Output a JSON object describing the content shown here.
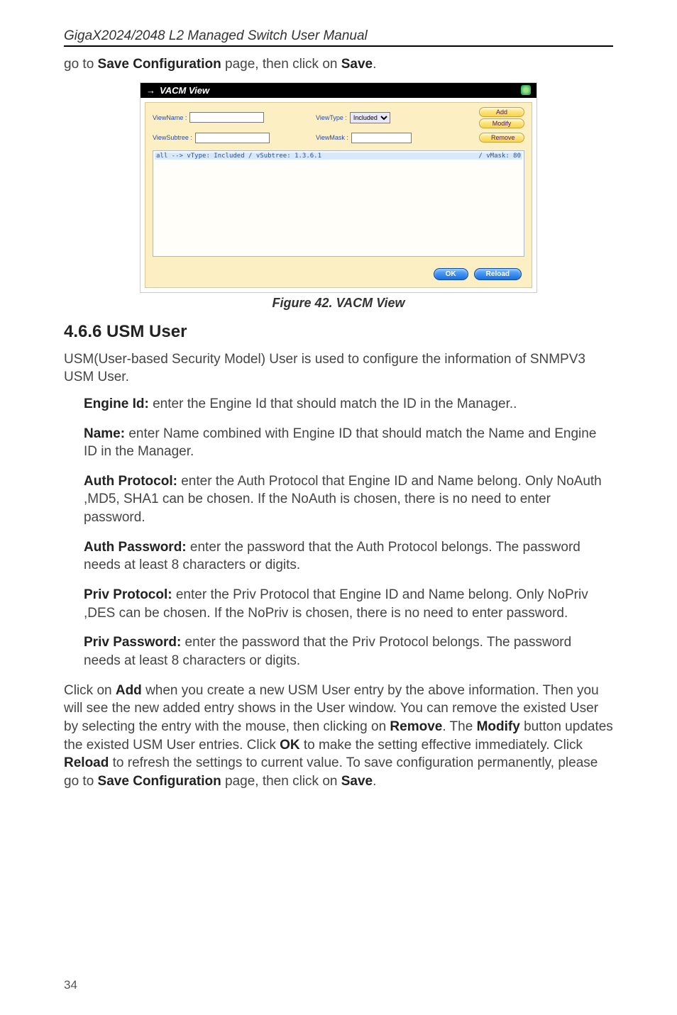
{
  "header": {
    "title": "GigaX2024/2048 L2 Managed Switch User Manual"
  },
  "intro_pre": "go to ",
  "intro_b1": "Save Configuration",
  "intro_mid": " page, then click on ",
  "intro_b2": "Save",
  "intro_end": ".",
  "figure": {
    "titlebar": "VACM View",
    "labels": {
      "viewname": "ViewName :",
      "viewtype": "ViewType :",
      "viewsubtree": "ViewSubtree :",
      "viewmask": "ViewMask :",
      "included_opt": "Included"
    },
    "buttons": {
      "add": "Add",
      "modify": "Modify",
      "remove": "Remove",
      "ok": "OK",
      "reload": "Reload"
    },
    "list_left": "all          --> vType: Included / vSubtree: 1.3.6.1",
    "list_right": "/ vMask: 80",
    "caption": "Figure 42. VACM View"
  },
  "section_heading": "4.6.6 USM User",
  "para1": "USM(User-based Security Model) User is used to configure the information of SNMPV3 USM User.",
  "engine": {
    "label": "Engine Id:",
    "text": " enter the Engine Id that should match the ID in the Manager.."
  },
  "name": {
    "label": "Name:",
    "text": " enter Name combined with Engine ID that should match the Name and Engine ID in the Manager."
  },
  "authproto": {
    "label": "Auth Protocol:",
    "text": " enter the Auth Protocol that Engine ID and Name belong. Only NoAuth ,MD5, SHA1 can be chosen. If the NoAuth is chosen, there is no need to enter password."
  },
  "authpass": {
    "label": "Auth Password:",
    "text": " enter the password that the Auth Protocol belongs. The password needs at least 8 characters or digits."
  },
  "privproto": {
    "label": "Priv Protocol:",
    "text": " enter the Priv Protocol that Engine ID and Name belong. Only NoPriv ,DES can be chosen. If the NoPriv is chosen, there is no need to enter password."
  },
  "privpass": {
    "label": "Priv Password:",
    "text": " enter the password that the Priv Protocol belongs. The password needs at least 8 characters or digits."
  },
  "final": {
    "t1": "Click on ",
    "b1": "Add",
    "t2": " when you create a new USM User entry by the above information. Then you will see the new added entry shows in the User window. You can remove the existed User by selecting the entry with the mouse, then clicking on ",
    "b2": "Remove",
    "t3": ". The ",
    "b3": "Modify",
    "t4": " button updates the existed USM User entries. Click ",
    "b4": "OK",
    "t5": " to make the setting effective immediately. Click ",
    "b5": "Reload",
    "t6": " to refresh the settings to current value. To save configuration permanently, please go to ",
    "b6": "Save Configuration",
    "t7": " page, then click on ",
    "b7": "Save",
    "t8": "."
  },
  "page_num": "34"
}
